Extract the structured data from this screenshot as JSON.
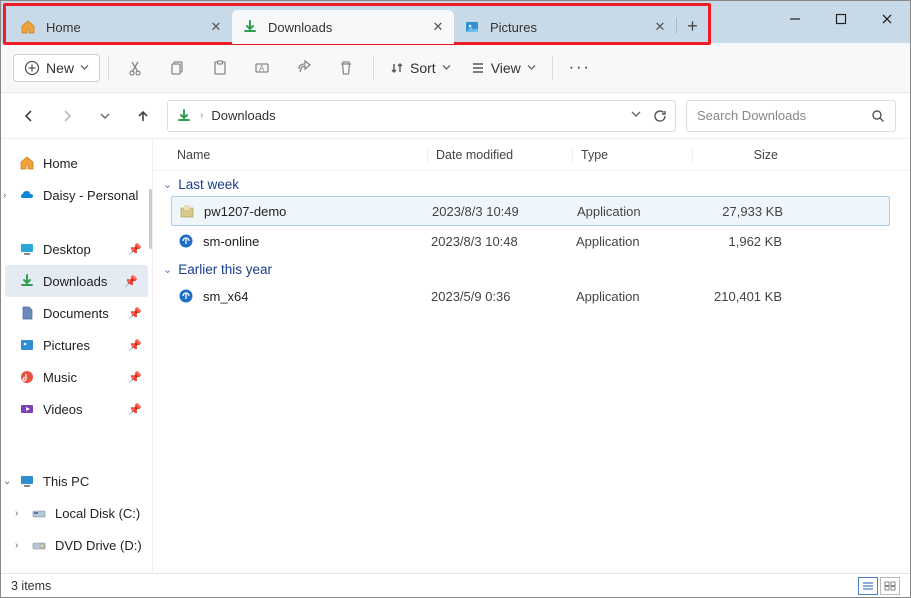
{
  "tabs": [
    {
      "label": "Home",
      "icon": "home"
    },
    {
      "label": "Downloads",
      "icon": "download",
      "active": true
    },
    {
      "label": "Pictures",
      "icon": "pictures"
    }
  ],
  "toolbar": {
    "new_label": "New",
    "sort_label": "Sort",
    "view_label": "View"
  },
  "address": {
    "location": "Downloads"
  },
  "search": {
    "placeholder": "Search Downloads"
  },
  "sidebar": {
    "home": "Home",
    "onedrive": "Daisy - Personal",
    "quick": [
      {
        "label": "Desktop",
        "icon": "desktop"
      },
      {
        "label": "Downloads",
        "icon": "download",
        "selected": true
      },
      {
        "label": "Documents",
        "icon": "documents"
      },
      {
        "label": "Pictures",
        "icon": "pictures"
      },
      {
        "label": "Music",
        "icon": "music"
      },
      {
        "label": "Videos",
        "icon": "videos"
      }
    ],
    "thispc": "This PC",
    "drives": [
      {
        "label": "Local Disk (C:)"
      },
      {
        "label": "DVD Drive (D:)"
      }
    ]
  },
  "columns": {
    "name": "Name",
    "date": "Date modified",
    "type": "Type",
    "size": "Size"
  },
  "groups": [
    {
      "title": "Last week",
      "rows": [
        {
          "name": "pw1207-demo",
          "date": "2023/8/3 10:49",
          "type": "Application",
          "size": "27,933 KB",
          "icon": "installer",
          "selected": true
        },
        {
          "name": "sm-online",
          "date": "2023/8/3 10:48",
          "type": "Application",
          "size": "1,962 KB",
          "icon": "app"
        }
      ]
    },
    {
      "title": "Earlier this year",
      "rows": [
        {
          "name": "sm_x64",
          "date": "2023/5/9 0:36",
          "type": "Application",
          "size": "210,401 KB",
          "icon": "app"
        }
      ]
    }
  ],
  "status": {
    "text": "3 items"
  }
}
